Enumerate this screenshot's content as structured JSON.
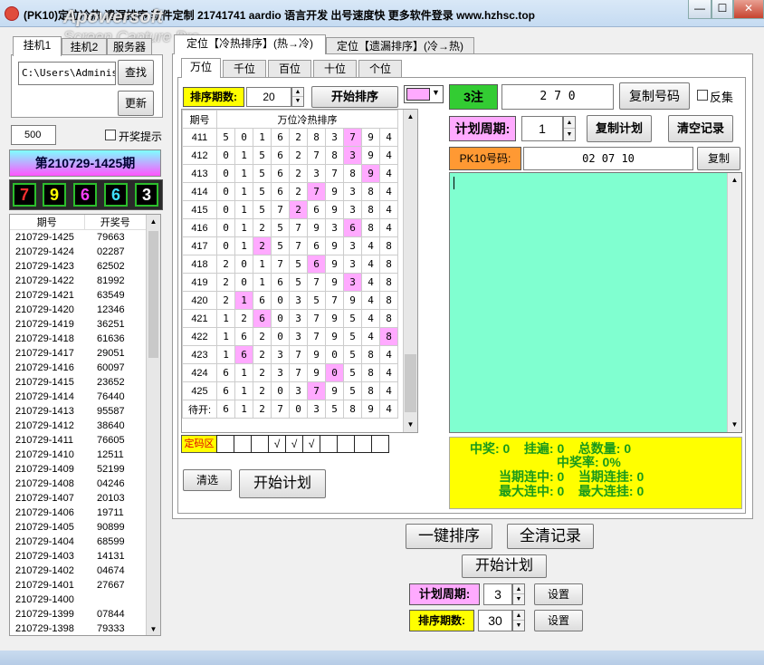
{
  "window": {
    "title": "(PK10)定位冷热  遗漏排序  软件定制 21741741  aardio 语言开发  出号速度快  更多软件登录  www.hzhsc.top",
    "watermark_line1": "Apowersoft",
    "watermark_line2": "Screen Capture Pro",
    "minimize": "—",
    "maximize": "☐",
    "close": "✕"
  },
  "left_tabs": [
    "挂机1",
    "挂机2",
    "服务器"
  ],
  "path_input": "C:\\Users\\Administ",
  "find_button": "查找",
  "update_button": "更新",
  "count_input": "500",
  "lottery_alert": "开奖提示",
  "period_banner": "第210729-1425期",
  "draw_numbers": [
    {
      "value": "7",
      "color": "#ff3030"
    },
    {
      "value": "9",
      "color": "#ffff00"
    },
    {
      "value": "6",
      "color": "#ff40ff"
    },
    {
      "value": "6",
      "color": "#40e0ff"
    },
    {
      "value": "3",
      "color": "#ffffff"
    }
  ],
  "history": {
    "headers": [
      "期号",
      "开奖号"
    ],
    "rows": [
      [
        "210729-1425",
        "79663"
      ],
      [
        "210729-1424",
        "02287"
      ],
      [
        "210729-1423",
        "62502"
      ],
      [
        "210729-1422",
        "81992"
      ],
      [
        "210729-1421",
        "63549"
      ],
      [
        "210729-1420",
        "12346"
      ],
      [
        "210729-1419",
        "36251"
      ],
      [
        "210729-1418",
        "61636"
      ],
      [
        "210729-1417",
        "29051"
      ],
      [
        "210729-1416",
        "60097"
      ],
      [
        "210729-1415",
        "23652"
      ],
      [
        "210729-1414",
        "76440"
      ],
      [
        "210729-1413",
        "95587"
      ],
      [
        "210729-1412",
        "38640"
      ],
      [
        "210729-1411",
        "76605"
      ],
      [
        "210729-1410",
        "12511"
      ],
      [
        "210729-1409",
        "52199"
      ],
      [
        "210729-1408",
        "04246"
      ],
      [
        "210729-1407",
        "20103"
      ],
      [
        "210729-1406",
        "19711"
      ],
      [
        "210729-1405",
        "90899"
      ],
      [
        "210729-1404",
        "68599"
      ],
      [
        "210729-1403",
        "14131"
      ],
      [
        "210729-1402",
        "04674"
      ],
      [
        "210729-1401",
        "27667"
      ],
      [
        "210729-1400",
        ""
      ],
      [
        "210729-1399",
        "07844"
      ],
      [
        "210729-1398",
        "79333"
      ]
    ]
  },
  "main_tabs": [
    "定位【冷热排序】(热→冷)",
    "定位【遗漏排序】(冷→热)"
  ],
  "position_tabs": [
    "万位",
    "千位",
    "百位",
    "十位",
    "个位"
  ],
  "sort_periods_label": "排序期数:",
  "sort_periods_value": "20",
  "start_sort_button": "开始排序",
  "color_swatch": "#ffaaff",
  "dropdown_arrow": "▼",
  "grid": {
    "col_period": "期号",
    "col_title": "万位冷热排序",
    "rows": [
      {
        "label": "411",
        "cells": [
          "5",
          "0",
          "1",
          "6",
          "2",
          "8",
          "3",
          "7",
          "9",
          "4"
        ],
        "hl": 7
      },
      {
        "label": "412",
        "cells": [
          "0",
          "1",
          "5",
          "6",
          "2",
          "7",
          "8",
          "3",
          "9",
          "4"
        ],
        "hl": 7
      },
      {
        "label": "413",
        "cells": [
          "0",
          "1",
          "5",
          "6",
          "2",
          "3",
          "7",
          "8",
          "9",
          "4"
        ],
        "hl": 8
      },
      {
        "label": "414",
        "cells": [
          "0",
          "1",
          "5",
          "6",
          "2",
          "7",
          "9",
          "3",
          "8",
          "4"
        ],
        "hl": 5
      },
      {
        "label": "415",
        "cells": [
          "0",
          "1",
          "5",
          "7",
          "2",
          "6",
          "9",
          "3",
          "8",
          "4"
        ],
        "hl": 4
      },
      {
        "label": "416",
        "cells": [
          "0",
          "1",
          "2",
          "5",
          "7",
          "9",
          "3",
          "6",
          "8",
          "4"
        ],
        "hl": 7
      },
      {
        "label": "417",
        "cells": [
          "0",
          "1",
          "2",
          "5",
          "7",
          "6",
          "9",
          "3",
          "4",
          "8"
        ],
        "hl": 2
      },
      {
        "label": "418",
        "cells": [
          "2",
          "0",
          "1",
          "7",
          "5",
          "6",
          "9",
          "3",
          "4",
          "8"
        ],
        "hl": 5
      },
      {
        "label": "419",
        "cells": [
          "2",
          "0",
          "1",
          "6",
          "5",
          "7",
          "9",
          "3",
          "4",
          "8"
        ],
        "hl": 7
      },
      {
        "label": "420",
        "cells": [
          "2",
          "1",
          "6",
          "0",
          "3",
          "5",
          "7",
          "9",
          "4",
          "8"
        ],
        "hl": 1
      },
      {
        "label": "421",
        "cells": [
          "1",
          "2",
          "6",
          "0",
          "3",
          "7",
          "9",
          "5",
          "4",
          "8"
        ],
        "hl": 2
      },
      {
        "label": "422",
        "cells": [
          "1",
          "6",
          "2",
          "0",
          "3",
          "7",
          "9",
          "5",
          "4",
          "8"
        ],
        "hl": 9
      },
      {
        "label": "423",
        "cells": [
          "1",
          "6",
          "2",
          "3",
          "7",
          "9",
          "0",
          "5",
          "8",
          "4"
        ],
        "hl": 1
      },
      {
        "label": "424",
        "cells": [
          "6",
          "1",
          "2",
          "3",
          "7",
          "9",
          "0",
          "5",
          "8",
          "4"
        ],
        "hl": 6
      },
      {
        "label": "425",
        "cells": [
          "6",
          "1",
          "2",
          "0",
          "3",
          "7",
          "9",
          "5",
          "8",
          "4"
        ],
        "hl": 5
      },
      {
        "label": "待开:",
        "cells": [
          "6",
          "1",
          "2",
          "7",
          "0",
          "3",
          "5",
          "8",
          "9",
          "4"
        ],
        "hl": -1
      }
    ]
  },
  "dingma": {
    "label": "定码区",
    "cells": [
      "",
      "",
      "",
      "√",
      "√",
      "√",
      "",
      "",
      "",
      ""
    ]
  },
  "clear_select_button": "清选",
  "start_plan_button": "开始计划",
  "bets_label": "3注",
  "bets_value": "2 7 0",
  "copy_numbers_button": "复制号码",
  "inverse_label": "反集",
  "plan_cycle_label": "计划周期:",
  "plan_cycle_value": "1",
  "copy_plan_button": "复制计划",
  "clear_records_button": "清空记录",
  "pk10_label": "PK10号码:",
  "pk10_value": "02 07 10",
  "copy_button": "复制",
  "stats": {
    "line1": "中奖: 0    挂遍: 0    总数量: 0",
    "line2": "中奖率: 0%",
    "line3": "当期连中: 0    当期连挂: 0",
    "line4": "最大连中: 0    最大连挂: 0"
  },
  "bottom": {
    "one_key_sort": "一键排序",
    "clear_all": "全清记录",
    "start_plan": "开始计划",
    "plan_cycle_label": "计划周期:",
    "plan_cycle_value": "3",
    "set1": "设置",
    "sort_periods_label": "排序期数:",
    "sort_periods_value": "30",
    "set2": "设置"
  }
}
